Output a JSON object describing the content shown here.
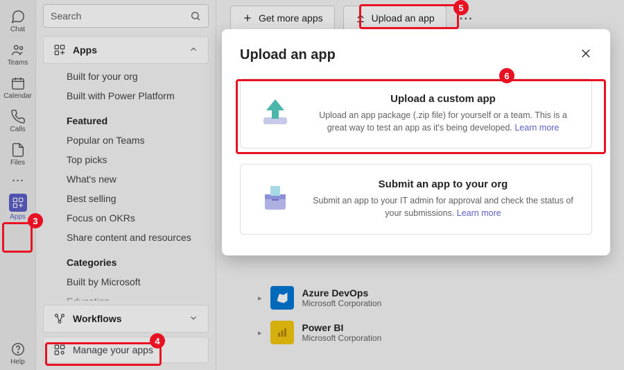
{
  "rail": {
    "chat": "Chat",
    "teams": "Teams",
    "calendar": "Calendar",
    "calls": "Calls",
    "files": "Files",
    "apps": "Apps",
    "help": "Help"
  },
  "sidebar": {
    "search_placeholder": "Search",
    "apps_header": "Apps",
    "links_top": [
      "Built for your org",
      "Built with Power Platform"
    ],
    "featured_heading": "Featured",
    "featured_links": [
      "Popular on Teams",
      "Top picks",
      "What's new",
      "Best selling",
      "Focus on OKRs",
      "Share content and resources"
    ],
    "categories_heading": "Categories",
    "categories_links": [
      "Built by Microsoft",
      "Education"
    ],
    "workflows": "Workflows",
    "manage": "Manage your apps"
  },
  "top": {
    "get_more": "Get more apps",
    "upload": "Upload an app"
  },
  "modal": {
    "title": "Upload an app",
    "card1_title": "Upload a custom app",
    "card1_desc": "Upload an app package (.zip file) for yourself or a team. This is a great way to test an app as it's being developed. ",
    "card1_link": "Learn more",
    "card2_title": "Submit an app to your org",
    "card2_desc": "Submit an app to your IT admin for approval and check the status of your submissions. ",
    "card2_link": "Learn more"
  },
  "apps": {
    "row1_title": "Azure DevOps",
    "row1_pub": "Microsoft Corporation",
    "row2_title": "Power BI",
    "row2_pub": "Microsoft Corporation"
  },
  "badges": {
    "b3": "3",
    "b4": "4",
    "b5": "5",
    "b6": "6"
  }
}
